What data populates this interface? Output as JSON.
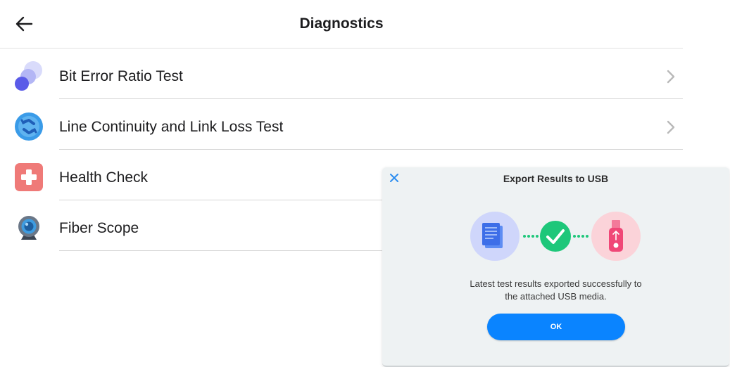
{
  "header": {
    "title": "Diagnostics",
    "back_icon": "arrow-left-icon"
  },
  "list": {
    "items": [
      {
        "label": "Bit Error Ratio Test",
        "icon": "bubbles-icon",
        "has_chevron": true
      },
      {
        "label": "Line Continuity and Link Loss Test",
        "icon": "cycle-icon",
        "has_chevron": true
      },
      {
        "label": "Health Check",
        "icon": "medical-cross-icon",
        "has_chevron": false
      },
      {
        "label": "Fiber Scope",
        "icon": "webcam-icon",
        "has_chevron": false
      }
    ]
  },
  "modal": {
    "title": "Export Results to USB",
    "message_line1": "Latest test results exported successfully to",
    "message_line2": "the attached USB media.",
    "ok_label": "OK",
    "close_icon": "close-icon"
  },
  "colors": {
    "accent": "#0a84ff",
    "success": "#1ec77a",
    "health_red": "#ef7a78",
    "cycle_blue": "#3a9be8",
    "usb_pink": "#f04777",
    "doc_blue": "#3d6ee8"
  }
}
